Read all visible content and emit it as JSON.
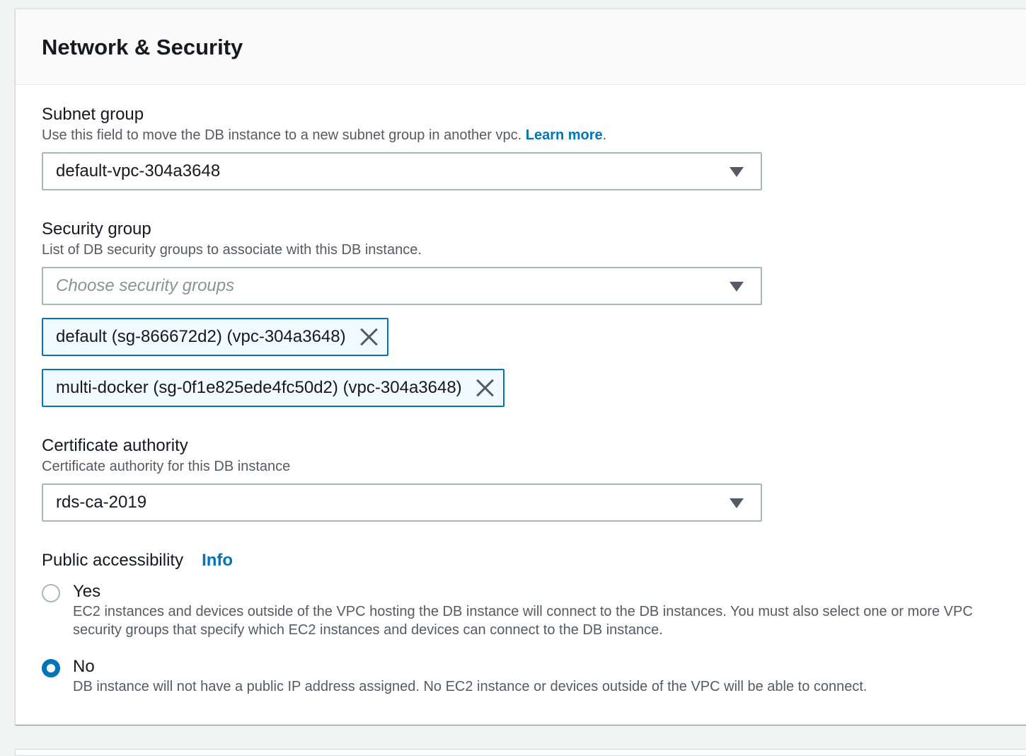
{
  "panel": {
    "title": "Network & Security"
  },
  "subnet_group": {
    "label": "Subnet group",
    "description": "Use this field to move the DB instance to a new subnet group in another vpc.",
    "learn_more": "Learn more",
    "period": ".",
    "value": "default-vpc-304a3648"
  },
  "security_group": {
    "label": "Security group",
    "description": "List of DB security groups to associate with this DB instance.",
    "placeholder": "Choose security groups",
    "tokens": [
      "default (sg-866672d2) (vpc-304a3648)",
      "multi-docker (sg-0f1e825ede4fc50d2) (vpc-304a3648)"
    ]
  },
  "certificate_authority": {
    "label": "Certificate authority",
    "description": "Certificate authority for this DB instance",
    "value": "rds-ca-2019"
  },
  "public_accessibility": {
    "label": "Public accessibility",
    "info": "Info",
    "options": [
      {
        "label": "Yes",
        "description": "EC2 instances and devices outside of the VPC hosting the DB instance will connect to the DB instances. You must also select one or more VPC security groups that specify which EC2 instances and devices can connect to the DB instance.",
        "checked": false
      },
      {
        "label": "No",
        "description": "DB instance will not have a public IP address assigned. No EC2 instance or devices outside of the VPC will be able to connect.",
        "checked": true
      }
    ]
  },
  "colors": {
    "accent": "#0073bb",
    "token_bg": "#f1faff",
    "border": "#aab7b8"
  }
}
